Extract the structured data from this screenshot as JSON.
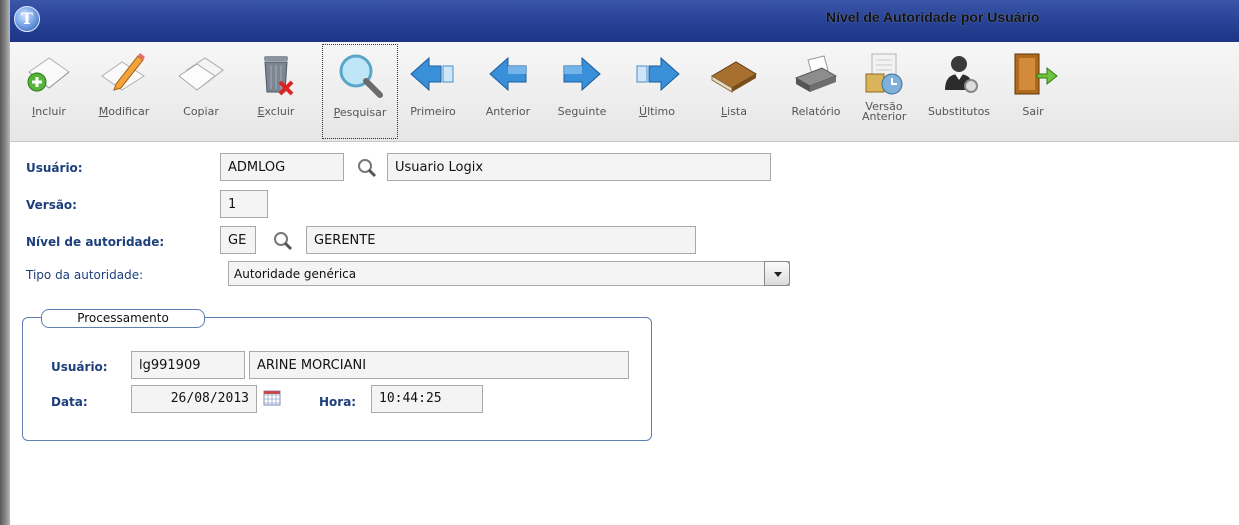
{
  "window": {
    "title": "Nível de Autoridade por Usuário"
  },
  "toolbar": {
    "buttons": [
      {
        "key": "I",
        "rest": "ncluir",
        "icon": "add-page-icon"
      },
      {
        "key": "M",
        "rest": "odificar",
        "icon": "edit-pencil-icon"
      },
      {
        "key": "",
        "rest": "Copiar",
        "icon": "copy-pages-icon"
      },
      {
        "key": "E",
        "rest": "xcluir",
        "icon": "trash-delete-icon"
      },
      {
        "key": "P",
        "rest": "esquisar",
        "icon": "magnifier-icon"
      },
      {
        "key": "",
        "rest": "Primeiro",
        "icon": "first-arrow-icon"
      },
      {
        "key": "",
        "rest": "Anterior",
        "icon": "previous-arrow-icon"
      },
      {
        "key": "",
        "rest": "Seguinte",
        "icon": "next-arrow-icon"
      },
      {
        "key": "Ú",
        "rest": "ltimo",
        "icon": "last-arrow-icon"
      },
      {
        "key": "L",
        "rest": "ista",
        "icon": "book-list-icon"
      },
      {
        "key": "",
        "rest": "Relatório",
        "icon": "printer-icon"
      },
      {
        "key": "",
        "rest": "Versão Anterior",
        "icon": "version-history-icon"
      },
      {
        "key": "",
        "rest": "Substitutos",
        "icon": "user-substitute-icon"
      },
      {
        "key": "",
        "rest": "Sair",
        "icon": "exit-door-icon"
      }
    ]
  },
  "form": {
    "usuario": {
      "label": "Usuário:",
      "code": "ADMLOG",
      "name": "Usuario Logix"
    },
    "versao": {
      "label": "Versão:",
      "value": "1"
    },
    "nivel": {
      "label": "Nível de autoridade:",
      "code": "GE",
      "name": "GERENTE"
    },
    "tipo": {
      "label": "Tipo da autoridade:",
      "value": "Autoridade genérica"
    }
  },
  "processamento": {
    "legend": "Processamento",
    "usuario_label": "Usuário:",
    "usuario_code": "lg991909",
    "usuario_name": "ARINE MORCIANI",
    "data_label": "Data:",
    "data_value": "26/08/2013",
    "hora_label": "Hora:",
    "hora_value": "10:44:25"
  },
  "colors": {
    "title_bar": "#2b469a",
    "label_text": "#1d3f7c",
    "group_border": "#5f7fb4"
  }
}
